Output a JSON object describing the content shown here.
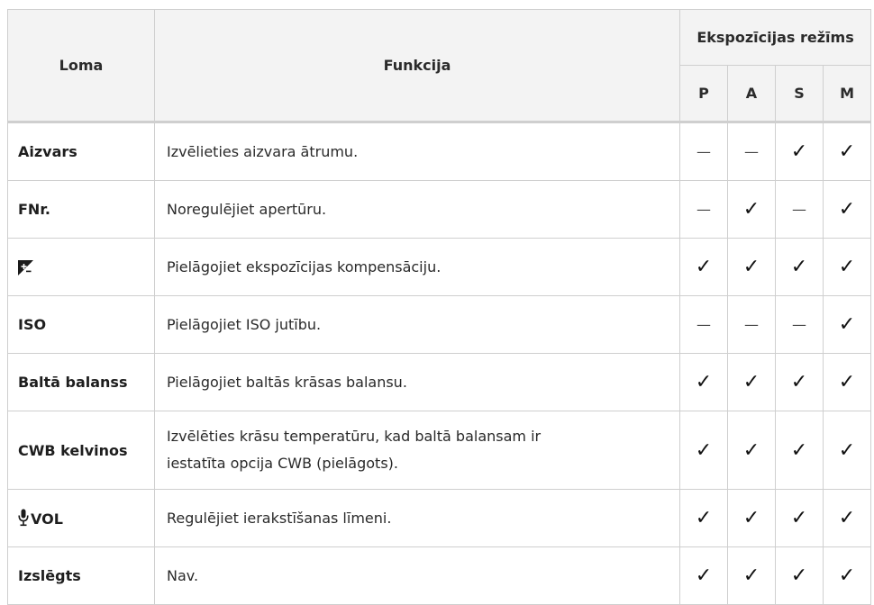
{
  "header": {
    "role": "Loma",
    "function": "Funkcija",
    "exposure_mode": "Ekspozīcijas režīms",
    "modes": [
      "P",
      "A",
      "S",
      "M"
    ]
  },
  "rows": [
    {
      "role": "Aizvars",
      "function": "Izvēlieties aizvara ātrumu.",
      "P": "—",
      "A": "—",
      "S": "✓",
      "M": "✓"
    },
    {
      "role": "FNr.",
      "function": "Noregulējiet apertūru.",
      "P": "—",
      "A": "✓",
      "S": "—",
      "M": "✓"
    },
    {
      "role_icon": "exposure-compensation-icon",
      "function": "Pielāgojiet ekspozīcijas kompensāciju.",
      "P": "✓",
      "A": "✓",
      "S": "✓",
      "M": "✓"
    },
    {
      "role": "ISO",
      "function": "Pielāgojiet ISO jutību.",
      "P": "—",
      "A": "—",
      "S": "—",
      "M": "✓"
    },
    {
      "role": "Baltā balanss",
      "function": "Pielāgojiet baltās krāsas balansu.",
      "P": "✓",
      "A": "✓",
      "S": "✓",
      "M": "✓"
    },
    {
      "role": "CWB kelvinos",
      "function_line1": "Izvēlēties krāsu temperatūru, kad baltā balansam ir",
      "function_line2": "iestatīta opcija CWB (pielāgots).",
      "P": "✓",
      "A": "✓",
      "S": "✓",
      "M": "✓"
    },
    {
      "role_icon": "microphone-icon",
      "role": "VOL",
      "function": "Regulējiet ierakstīšanas līmeni.",
      "P": "✓",
      "A": "✓",
      "S": "✓",
      "M": "✓"
    },
    {
      "role": "Izslēgts",
      "function": "Nav.",
      "P": "✓",
      "A": "✓",
      "S": "✓",
      "M": "✓"
    }
  ]
}
